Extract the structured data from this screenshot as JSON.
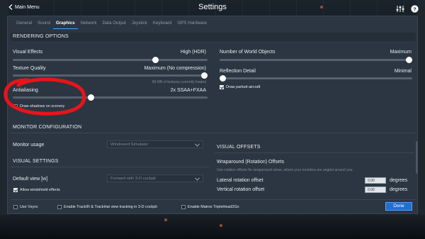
{
  "header": {
    "back_label": "Main Menu",
    "title": "Settings"
  },
  "tabs": [
    {
      "label": "General",
      "active": false
    },
    {
      "label": "Sound",
      "active": false
    },
    {
      "label": "Graphics",
      "active": true
    },
    {
      "label": "Network",
      "active": false
    },
    {
      "label": "Data Output",
      "active": false
    },
    {
      "label": "Joystick",
      "active": false
    },
    {
      "label": "Keyboard",
      "active": false
    },
    {
      "label": "GPS Hardware",
      "active": false
    }
  ],
  "rendering": {
    "section_title": "RENDERING OPTIONS",
    "visual_effects": {
      "label": "Visual Effects",
      "value": "High (HDR)",
      "level": 0.74
    },
    "texture_quality": {
      "label": "Texture Quality",
      "value": "Maximum (No compression)",
      "level": 1.0,
      "note": "89 MB of textures currently loaded"
    },
    "antialiasing": {
      "label": "Antialiasing",
      "value": "2x SSAA+FXAA",
      "level": 0.4
    },
    "draw_shadows": {
      "label": "Draw shadows on scenery",
      "checked": false
    },
    "world_objects": {
      "label": "Number of World Objects",
      "value": "Maximum",
      "level": 1.0
    },
    "reflection_detail": {
      "label": "Reflection Detail",
      "value": "Minimal",
      "level": 0.0
    },
    "draw_parked_aircraft": {
      "label": "Draw parked aircraft",
      "checked": true
    }
  },
  "monitor": {
    "section_title": "MONITOR CONFIGURATION",
    "usage_label": "Monitor usage",
    "usage_value": "Windowed Simulator"
  },
  "visual_settings": {
    "section_title": "VISUAL SETTINGS",
    "default_view_label": "Default view [w]",
    "default_view_value": "Forward with 3-D cockpit",
    "windshield_effects": {
      "label": "Allow windshield effects",
      "checked": true
    }
  },
  "visual_offsets": {
    "section_title": "VISUAL OFFSETS",
    "subtitle": "Wraparound (Rotation) Offsets",
    "description": "Use rotation offsets for wraparound views, where your monitors are angled around you.",
    "lateral": {
      "label": "Lateral rotation offset",
      "value": "0.00",
      "unit": "degrees"
    },
    "vertical": {
      "label": "Vertical rotation offset",
      "value": "0.00",
      "unit": "degrees"
    }
  },
  "footer": {
    "use_vsync": {
      "label": "Use Vsync",
      "checked": false
    },
    "trackir": {
      "label": "Enable TrackIR & TrackHat view tracking in 3-D cockpit",
      "checked": false
    },
    "matrox": {
      "label": "Enable Matrox TripleHead2Go",
      "checked": false
    },
    "done_label": "Done"
  },
  "colors": {
    "accent": "#1d6fd6",
    "panel": "#2b3642",
    "annotation": "#e8141a"
  },
  "icons": {
    "back": "chevron-left-icon",
    "adjust": "sliders-icon",
    "help": "help-icon"
  }
}
